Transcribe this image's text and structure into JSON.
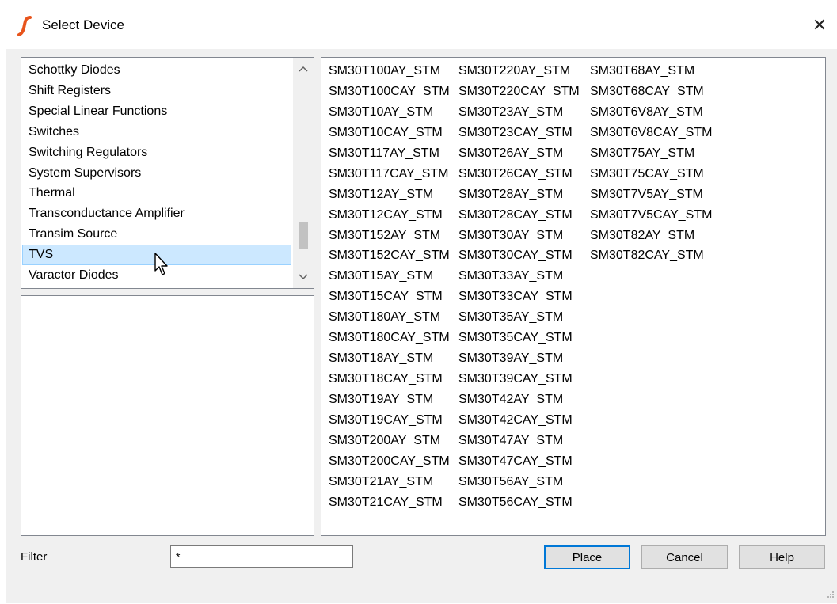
{
  "window": {
    "title": "Select Device",
    "close_glyph": "✕"
  },
  "category_list": {
    "items": [
      "Schottky Diodes",
      "Shift Registers",
      "Special Linear Functions",
      "Switches",
      "Switching Regulators",
      "System Supervisors",
      "Thermal",
      "Transconductance Amplifier",
      "Transim Source",
      "TVS",
      "Varactor Diodes"
    ],
    "selected": "TVS",
    "scroll_up_glyph": "︿",
    "scroll_down_glyph": "﹀"
  },
  "device_list": {
    "columns": [
      [
        "SM30T100AY_STM",
        "SM30T100CAY_STM",
        "SM30T10AY_STM",
        "SM30T10CAY_STM",
        "SM30T117AY_STM",
        "SM30T117CAY_STM",
        "SM30T12AY_STM",
        "SM30T12CAY_STM",
        "SM30T152AY_STM",
        "SM30T152CAY_STM",
        "SM30T15AY_STM",
        "SM30T15CAY_STM",
        "SM30T180AY_STM",
        "SM30T180CAY_STM",
        "SM30T18AY_STM",
        "SM30T18CAY_STM",
        "SM30T19AY_STM",
        "SM30T19CAY_STM",
        "SM30T200AY_STM",
        "SM30T200CAY_STM",
        "SM30T21AY_STM",
        "SM30T21CAY_STM"
      ],
      [
        "SM30T220AY_STM",
        "SM30T220CAY_STM",
        "SM30T23AY_STM",
        "SM30T23CAY_STM",
        "SM30T26AY_STM",
        "SM30T26CAY_STM",
        "SM30T28AY_STM",
        "SM30T28CAY_STM",
        "SM30T30AY_STM",
        "SM30T30CAY_STM",
        "SM30T33AY_STM",
        "SM30T33CAY_STM",
        "SM30T35AY_STM",
        "SM30T35CAY_STM",
        "SM30T39AY_STM",
        "SM30T39CAY_STM",
        "SM30T42AY_STM",
        "SM30T42CAY_STM",
        "SM30T47AY_STM",
        "SM30T47CAY_STM",
        "SM30T56AY_STM",
        "SM30T56CAY_STM"
      ],
      [
        "SM30T68AY_STM",
        "SM30T68CAY_STM",
        "SM30T6V8AY_STM",
        "SM30T6V8CAY_STM",
        "SM30T75AY_STM",
        "SM30T75CAY_STM",
        "SM30T7V5AY_STM",
        "SM30T7V5CAY_STM",
        "SM30T82AY_STM",
        "SM30T82CAY_STM"
      ]
    ]
  },
  "filter": {
    "label": "Filter",
    "value": "*"
  },
  "buttons": {
    "place": "Place",
    "cancel": "Cancel",
    "help": "Help"
  },
  "colors": {
    "selection_bg": "#cce8ff",
    "default_button_border": "#0078d7",
    "app_icon": "#e8541c"
  },
  "icons": {
    "app": "simetrix-logo-icon",
    "close": "close-icon",
    "cursor": "mouse-pointer-icon"
  }
}
